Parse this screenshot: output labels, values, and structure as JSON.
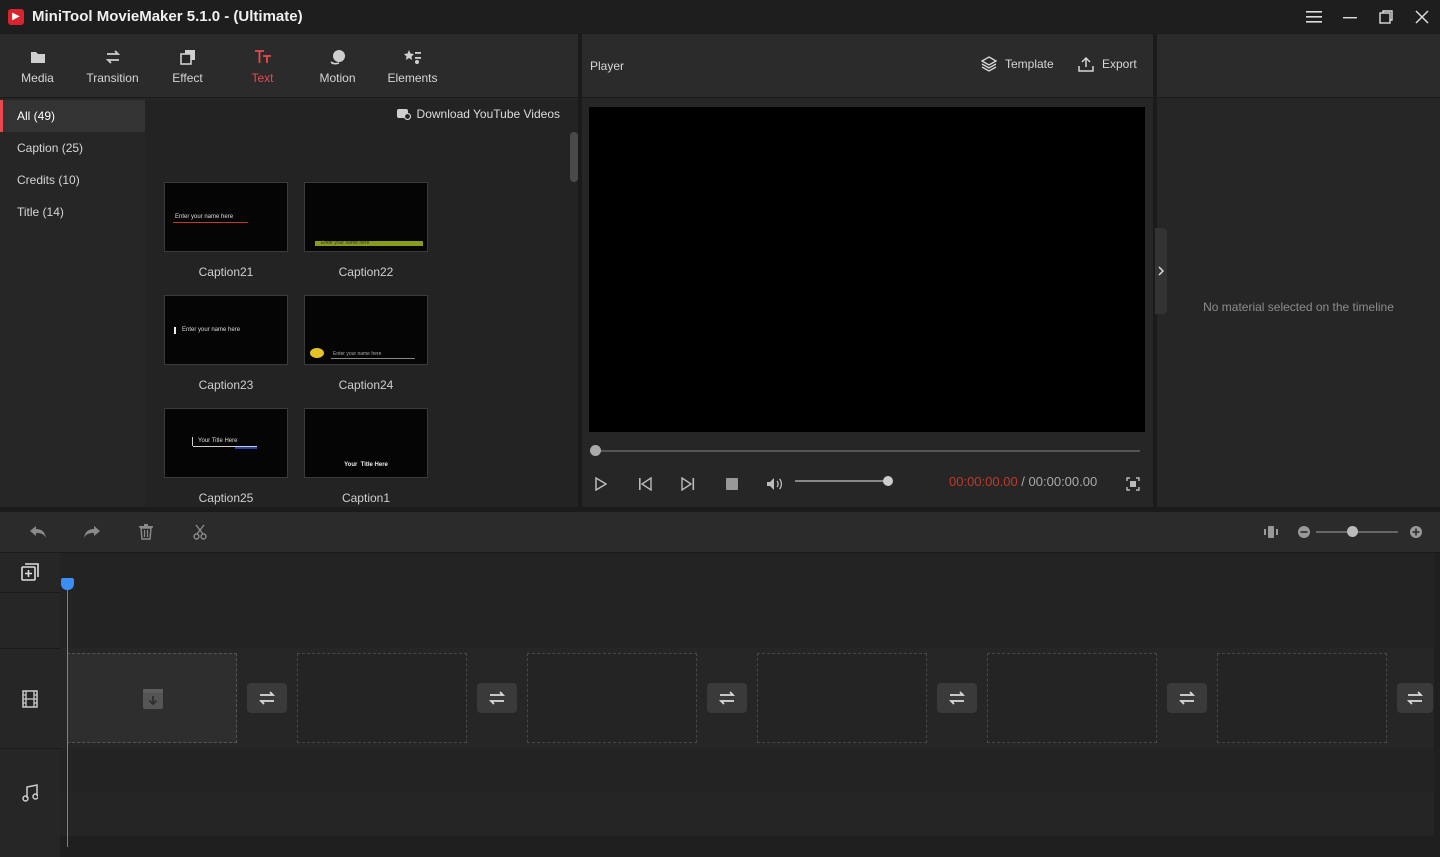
{
  "window": {
    "title": "MiniTool MovieMaker 5.1.0 - (Ultimate)"
  },
  "toolbar": {
    "items": [
      {
        "label": "Media",
        "icon": "folder-icon"
      },
      {
        "label": "Transition",
        "icon": "swap-icon"
      },
      {
        "label": "Effect",
        "icon": "layers-icon"
      },
      {
        "label": "Text",
        "icon": "text-icon"
      },
      {
        "label": "Motion",
        "icon": "motion-icon"
      },
      {
        "label": "Elements",
        "icon": "elements-icon"
      }
    ],
    "active": "Text"
  },
  "categories": [
    {
      "label": "All (49)"
    },
    {
      "label": "Caption (25)"
    },
    {
      "label": "Credits (10)"
    },
    {
      "label": "Title (14)"
    }
  ],
  "content": {
    "download_link": "Download YouTube Videos",
    "thumbnails": [
      {
        "label": "Caption21",
        "preview": "Enter your name here"
      },
      {
        "label": "Caption22",
        "preview": "Enter your name here"
      },
      {
        "label": "Caption23",
        "preview": "Enter your name here"
      },
      {
        "label": "Caption24",
        "preview": "Enter your name here"
      },
      {
        "label": "Caption25",
        "preview": "Your Title Here"
      },
      {
        "label": "Caption1",
        "preview": "Your  Title Here"
      }
    ]
  },
  "player": {
    "label": "Player",
    "template_label": "Template",
    "export_label": "Export",
    "time_current": "00:00:00.00",
    "time_separator": " / ",
    "time_total": "00:00:00.00"
  },
  "properties": {
    "empty_message": "No material selected on the timeline"
  },
  "colors": {
    "accent": "#e9484d",
    "playhead": "#3a8ef5",
    "timecode_current": "#c0392b"
  }
}
